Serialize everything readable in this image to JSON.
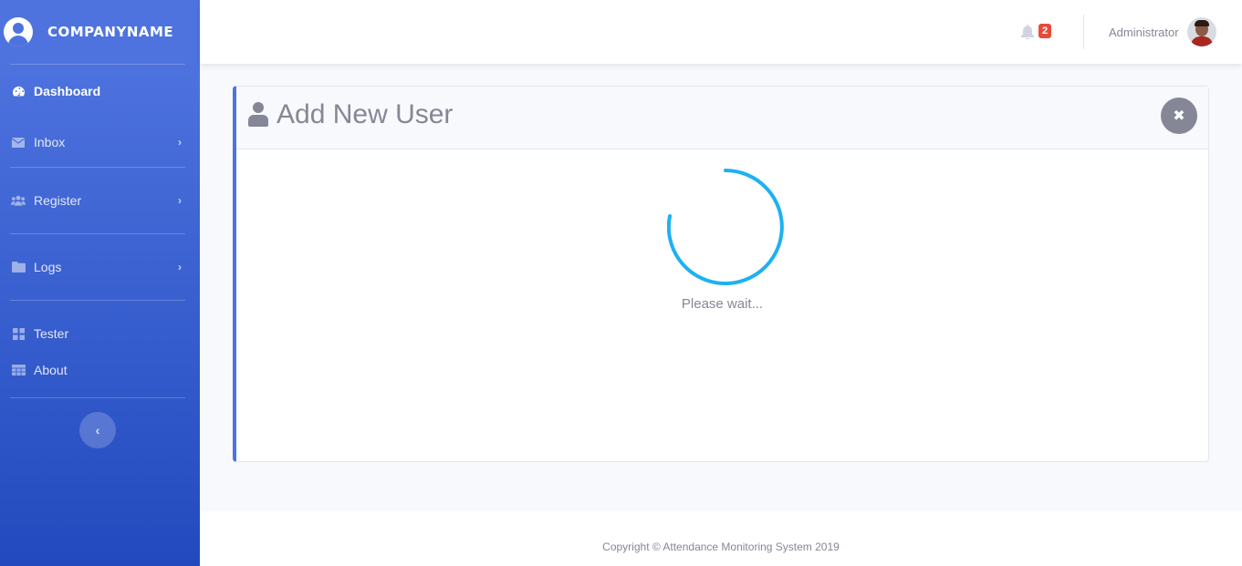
{
  "sidebar": {
    "brand": "COMPANYNAME",
    "items": [
      {
        "label": "Dashboard",
        "icon": "tachometer-icon",
        "active": true
      },
      {
        "label": "Inbox",
        "icon": "envelope-icon",
        "has_submenu": true
      },
      {
        "label": "Register",
        "icon": "users-icon",
        "has_submenu": true
      },
      {
        "label": "Logs",
        "icon": "folder-icon",
        "has_submenu": true
      },
      {
        "label": "Tester",
        "icon": "grid-icon"
      },
      {
        "label": "About",
        "icon": "table-icon"
      }
    ],
    "chevron": "›",
    "toggle_glyph": "‹"
  },
  "topbar": {
    "notification_count": "2",
    "user_name": "Administrator"
  },
  "card": {
    "title": "Add New User",
    "close_glyph": "✖",
    "loading_text": "Please wait..."
  },
  "footer": {
    "copyright": "Copyright © Attendance Monitoring System 2019"
  },
  "colors": {
    "primary": "#4e73df",
    "primary_dark": "#224abe",
    "spinner": "#1eb1f0",
    "badge": "#e74a3b",
    "muted": "#858796"
  }
}
